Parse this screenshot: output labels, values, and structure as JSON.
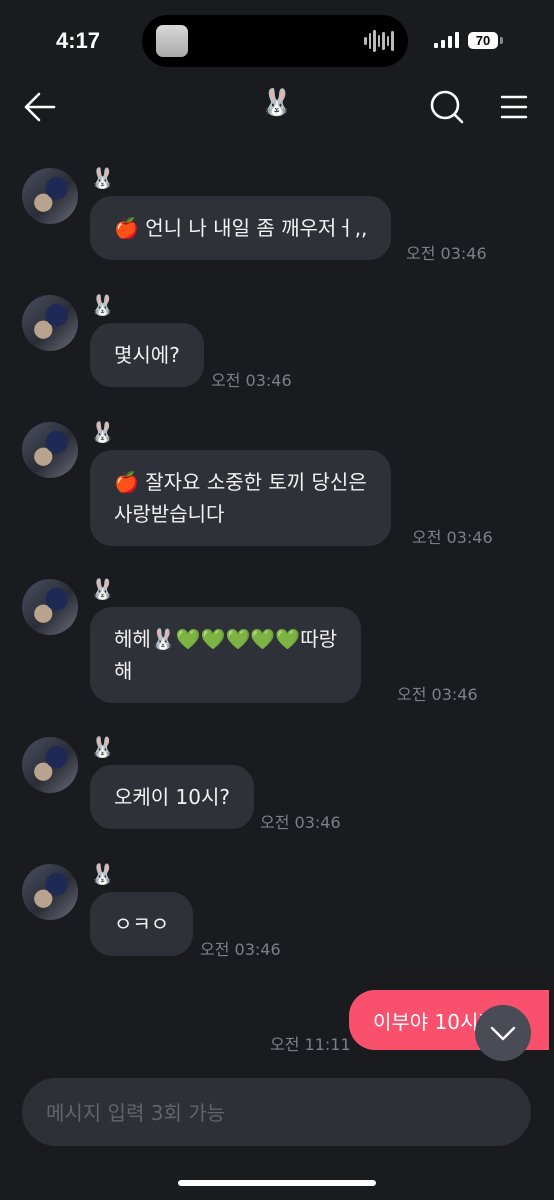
{
  "status_bar": {
    "time": "4:17",
    "battery": "70"
  },
  "header": {
    "title": "🐰"
  },
  "messages": [
    {
      "sender": "🐰",
      "text": "🍎 언니 나 내일 좀 깨우저ㅓ,,",
      "time": "오전 03:46"
    },
    {
      "sender": "🐰",
      "text": "몇시에?",
      "time": "오전 03:46"
    },
    {
      "sender": "🐰",
      "text": "🍎 잘자요 소중한 토끼 당신은\n사랑받습니다",
      "time": "오전 03:46"
    },
    {
      "sender": "🐰",
      "text": "헤헤🐰💚💚💚💚💚따랑\n해",
      "time": "오전 03:46"
    },
    {
      "sender": "🐰",
      "text": "오케이 10시?",
      "time": "오전 03:46"
    },
    {
      "sender": "🐰",
      "text": "ㅇㅋㅇ",
      "time": "오전 03:46"
    }
  ],
  "outgoing": {
    "text": "이부야 10시지",
    "time": "오전 11:11"
  },
  "composer": {
    "placeholder": "메시지 입력 3회 가능"
  },
  "colors": {
    "background": "#1a1b1f",
    "bubble_in": "#2f3139",
    "bubble_out": "#f8506d",
    "timestamp": "#7e7f86"
  }
}
